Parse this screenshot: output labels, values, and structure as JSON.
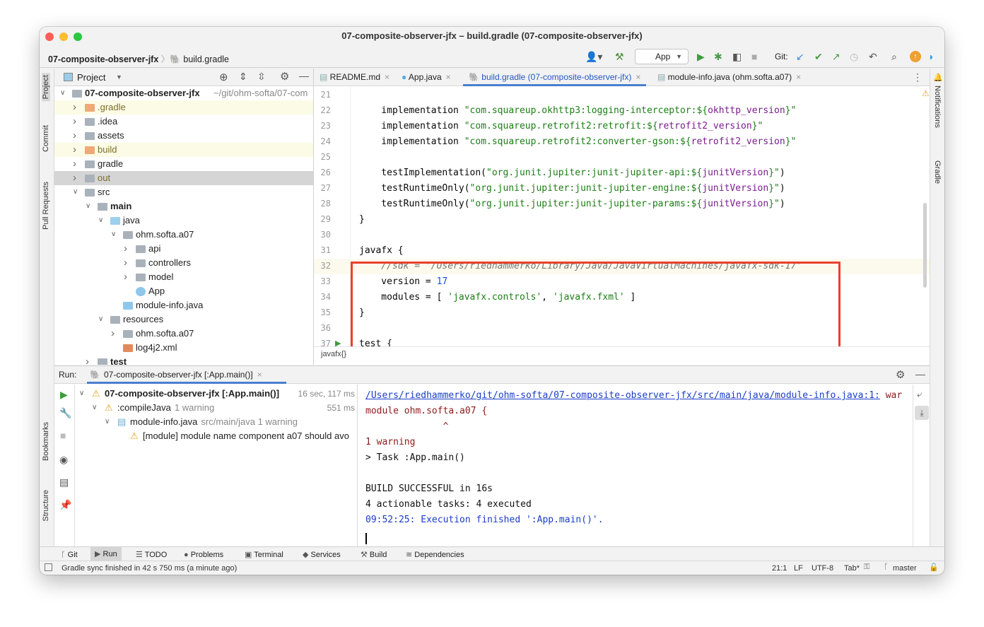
{
  "window": {
    "title": "07-composite-observer-jfx – build.gradle (07-composite-observer-jfx)"
  },
  "navbar": {
    "project": "07-composite-observer-jfx",
    "file": "build.gradle",
    "run_config": "App",
    "git_label": "Git:"
  },
  "left_strip": [
    "Project",
    "Commit",
    "Pull Requests",
    "Bookmarks",
    "Structure"
  ],
  "right_strip": [
    "Notifications",
    "Gradle"
  ],
  "project_panel": {
    "title": "Project",
    "root": {
      "name": "07-composite-observer-jfx",
      "path": "~/git/ohm-softa/07-com"
    },
    "items": [
      {
        "name": ".gradle",
        "level": 1,
        "arrow": "right",
        "icon": "folder-excluded",
        "style": "excluded"
      },
      {
        "name": ".idea",
        "level": 1,
        "arrow": "right",
        "icon": "folder"
      },
      {
        "name": "assets",
        "level": 1,
        "arrow": "right",
        "icon": "folder"
      },
      {
        "name": "build",
        "level": 1,
        "arrow": "right",
        "icon": "folder-excluded",
        "style": "excluded"
      },
      {
        "name": "gradle",
        "level": 1,
        "arrow": "right",
        "icon": "folder"
      },
      {
        "name": "out",
        "level": 1,
        "arrow": "right",
        "icon": "folder",
        "style": "selected"
      },
      {
        "name": "src",
        "level": 1,
        "arrow": "down",
        "icon": "folder"
      },
      {
        "name": "main",
        "level": 2,
        "arrow": "down",
        "icon": "module-folder",
        "bold": true
      },
      {
        "name": "java",
        "level": 3,
        "arrow": "down",
        "icon": "source-folder"
      },
      {
        "name": "ohm.softa.a07",
        "level": 4,
        "arrow": "down",
        "icon": "package"
      },
      {
        "name": "api",
        "level": 5,
        "arrow": "right",
        "icon": "package"
      },
      {
        "name": "controllers",
        "level": 5,
        "arrow": "right",
        "icon": "package"
      },
      {
        "name": "model",
        "level": 5,
        "arrow": "right",
        "icon": "package"
      },
      {
        "name": "App",
        "level": 5,
        "arrow": "",
        "icon": "java-class"
      },
      {
        "name": "module-info.java",
        "level": 4,
        "arrow": "",
        "icon": "java-file"
      },
      {
        "name": "resources",
        "level": 3,
        "arrow": "down",
        "icon": "resources-folder"
      },
      {
        "name": "ohm.softa.a07",
        "level": 4,
        "arrow": "right",
        "icon": "folder"
      },
      {
        "name": "log4j2.xml",
        "level": 4,
        "arrow": "",
        "icon": "xml-file"
      },
      {
        "name": "test",
        "level": 2,
        "arrow": "right",
        "icon": "module-folder",
        "bold": true
      }
    ]
  },
  "editor": {
    "tabs": [
      {
        "label": "README.md",
        "icon": "markdown-icon"
      },
      {
        "label": "App.java",
        "icon": "java-class-icon"
      },
      {
        "label": "build.gradle (07-composite-observer-jfx)",
        "icon": "gradle-icon",
        "active": true
      },
      {
        "label": "module-info.java (ohm.softa.a07)",
        "icon": "java-file-icon"
      }
    ],
    "lines": [
      {
        "n": "21",
        "seg": []
      },
      {
        "n": "22",
        "seg": [
          [
            "    implementation ",
            ""
          ],
          [
            "\"com.squareup.okhttp3:logging-interceptor:${",
            "s-str"
          ],
          [
            "okhttp_version",
            "s-var"
          ],
          [
            "}\"",
            "s-str"
          ]
        ]
      },
      {
        "n": "23",
        "seg": [
          [
            "    implementation ",
            ""
          ],
          [
            "\"com.squareup.retrofit2:retrofit:${",
            "s-str"
          ],
          [
            "retrofit2_version",
            "s-var"
          ],
          [
            "}\"",
            "s-str"
          ]
        ]
      },
      {
        "n": "24",
        "seg": [
          [
            "    implementation ",
            ""
          ],
          [
            "\"com.squareup.retrofit2:converter-gson:${",
            "s-str"
          ],
          [
            "retrofit2_version",
            "s-var"
          ],
          [
            "}\"",
            "s-str"
          ]
        ]
      },
      {
        "n": "25",
        "seg": []
      },
      {
        "n": "26",
        "seg": [
          [
            "    testImplementation(",
            ""
          ],
          [
            "\"org.junit.jupiter:junit-jupiter-api:${",
            "s-str"
          ],
          [
            "junitVersion",
            "s-var"
          ],
          [
            "}\"",
            "s-str"
          ],
          [
            ")",
            ""
          ]
        ]
      },
      {
        "n": "27",
        "seg": [
          [
            "    testRuntimeOnly(",
            ""
          ],
          [
            "\"org.junit.jupiter:junit-jupiter-engine:${",
            "s-str"
          ],
          [
            "junitVersion",
            "s-var"
          ],
          [
            "}\"",
            "s-str"
          ],
          [
            ")",
            ""
          ]
        ]
      },
      {
        "n": "28",
        "seg": [
          [
            "    testRuntimeOnly(",
            ""
          ],
          [
            "\"org.junit.jupiter:junit-jupiter-params:${",
            "s-str"
          ],
          [
            "junitVersion",
            "s-var"
          ],
          [
            "}\"",
            "s-str"
          ],
          [
            ")",
            ""
          ]
        ]
      },
      {
        "n": "29",
        "seg": [
          [
            "}",
            ""
          ]
        ]
      },
      {
        "n": "30",
        "seg": []
      },
      {
        "n": "31",
        "seg": [
          [
            "javafx {",
            ""
          ]
        ]
      },
      {
        "n": "32",
        "seg": [
          [
            "    //sdk = '/Users/riedhammerko/Library/Java/JavaVirtualMachines/javafx-sdk-17'",
            "s-cmt"
          ]
        ],
        "current": true
      },
      {
        "n": "33",
        "seg": [
          [
            "    version = ",
            ""
          ],
          [
            "17",
            "s-num"
          ]
        ]
      },
      {
        "n": "34",
        "seg": [
          [
            "    modules = [ ",
            ""
          ],
          [
            "'javafx.controls'",
            "s-str"
          ],
          [
            ", ",
            ""
          ],
          [
            "'javafx.fxml'",
            "s-str"
          ],
          [
            " ]",
            ""
          ]
        ]
      },
      {
        "n": "35",
        "seg": [
          [
            "}",
            ""
          ]
        ]
      },
      {
        "n": "36",
        "seg": []
      },
      {
        "n": "37",
        "seg": [
          [
            "test {",
            ""
          ]
        ]
      }
    ],
    "breadcrumb": "javafx{}",
    "highlight_color": "#e8412c"
  },
  "run_panel": {
    "label": "Run:",
    "tab": "07-composite-observer-jfx [:App.main()]",
    "tree": [
      {
        "text": "07-composite-observer-jfx [:App.main()]",
        "extra": "16 sec, 117 ms",
        "level": 0,
        "bold": true,
        "icon": "warning"
      },
      {
        "text": ":compileJava",
        "muted": "1 warning",
        "extra": "551 ms",
        "level": 1,
        "icon": "warning"
      },
      {
        "text": "module-info.java",
        "muted": "src/main/java 1 warning",
        "level": 2,
        "icon": "java-file"
      },
      {
        "text": "[module] module name component a07 should avo",
        "level": 3,
        "icon": "warning"
      }
    ],
    "console": [
      {
        "t": "/Users/riedhammerko/git/ohm-softa/07-composite-observer-jfx/src/main/java/module-info.java:1:",
        "c": "link",
        "tail": " war"
      },
      {
        "t": "module ohm.softa.a07 {",
        "c": "err"
      },
      {
        "t": "              ^",
        "c": "err"
      },
      {
        "t": "1 warning",
        "c": "err"
      },
      {
        "t": "> Task :App.main()",
        "c": ""
      },
      {
        "t": "",
        "c": ""
      },
      {
        "t": "BUILD SUCCESSFUL in 16s",
        "c": ""
      },
      {
        "t": "4 actionable tasks: 4 executed",
        "c": ""
      },
      {
        "t": "09:52:25: Execution finished ':App.main()'.",
        "c": "info"
      }
    ]
  },
  "bottom_tabs": [
    "Git",
    "Run",
    "TODO",
    "Problems",
    "Terminal",
    "Services",
    "Build",
    "Dependencies"
  ],
  "status": {
    "message": "Gradle sync finished in 42 s 750 ms (a minute ago)",
    "position": "21:1",
    "line_sep": "LF",
    "encoding": "UTF-8",
    "indent": "Tab*",
    "branch": "master"
  }
}
